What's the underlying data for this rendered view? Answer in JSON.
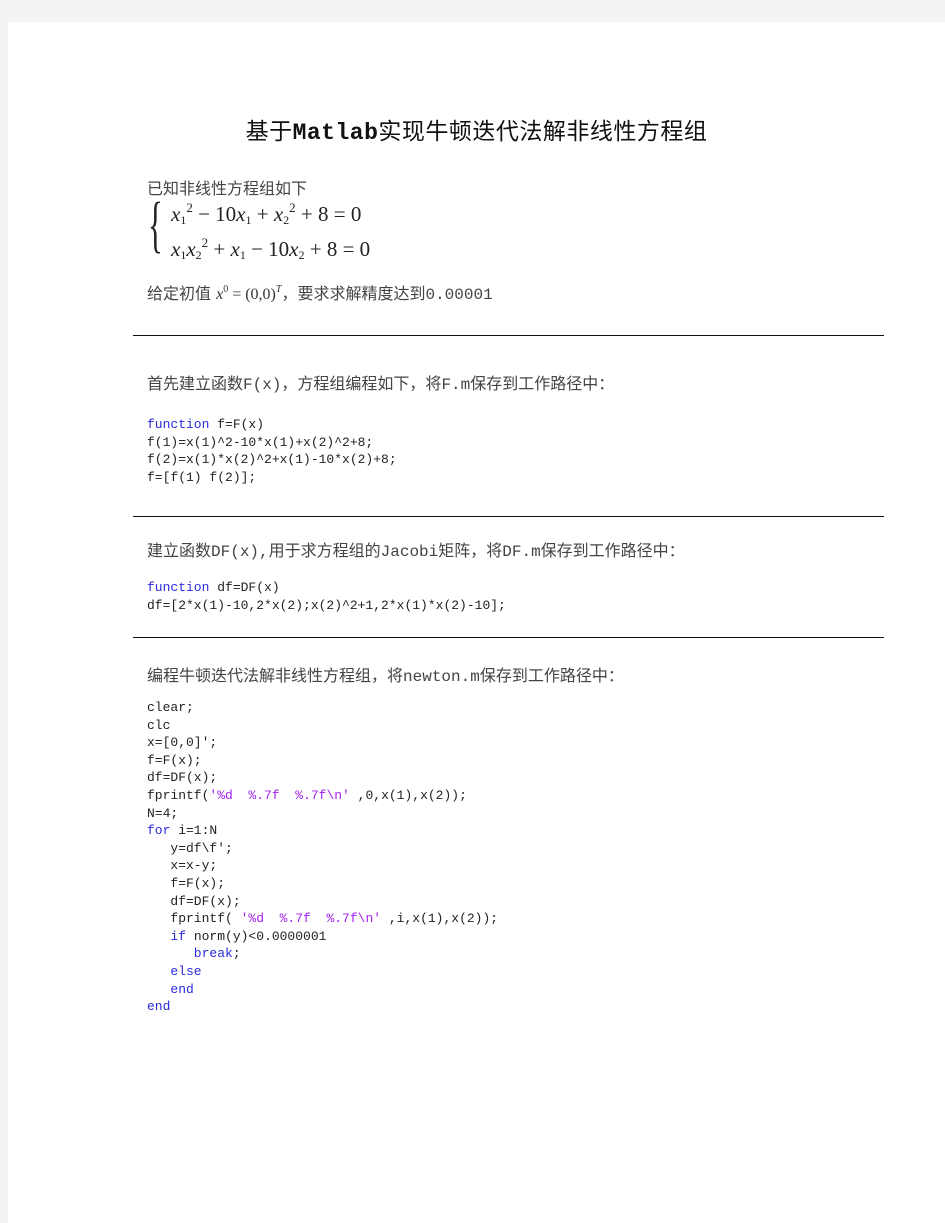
{
  "document": {
    "title_prefix": "基于",
    "title_mono": "Matlab",
    "title_suffix": "实现牛顿迭代法解非线性方程组",
    "intro": "已知非线性方程组如下",
    "equations": {
      "eq1": {
        "t1": "x",
        "s1": "1",
        "p1": "2",
        "t2": " − 10",
        "t3": "x",
        "s3": "1",
        "t4": " + ",
        "t5": "x",
        "s5": "2",
        "p5": "2",
        "t6": " + 8 = 0"
      },
      "eq2": {
        "t1": "x",
        "s1": "1",
        "t2": "x",
        "s2": "2",
        "p2": "2",
        "t3": " + ",
        "t4": "x",
        "s4": "1",
        "t5": " − 10",
        "t6": "x",
        "s6": "2",
        "t7": " + 8 = 0"
      }
    },
    "initial": {
      "prefix": "给定初值 ",
      "var": "x",
      "var_sup": "0",
      "eq": " = (0,0)",
      "transpose": "T",
      "mid": "，要求求解精度达到",
      "precision": "0.00001"
    },
    "sections": [
      {
        "heading_parts": [
          "首先建立函数",
          "F(x)",
          "，方程组编程如下，将",
          "F.m",
          "保存到工作路径中："
        ],
        "code": [
          [
            {
              "kw": "function"
            },
            {
              "t": " f=F(x)"
            }
          ],
          [
            {
              "t": "f(1)=x(1)^2-10*x(1)+x(2)^2+8;"
            }
          ],
          [
            {
              "t": "f(2)=x(1)*x(2)^2+x(1)-10*x(2)+8;"
            }
          ],
          [
            {
              "t": "f=[f(1) f(2)];"
            }
          ]
        ]
      },
      {
        "heading_parts": [
          "建立函数",
          "DF(x),",
          "用于求方程组的",
          "Jacobi",
          "矩阵，将",
          "DF.m",
          "保存到工作路径中："
        ],
        "code": [
          [
            {
              "kw": "function"
            },
            {
              "t": " df=DF(x)"
            }
          ],
          [
            {
              "t": "df=[2*x(1)-10,2*x(2);x(2)^2+1,2*x(1)*x(2)-10];"
            }
          ]
        ]
      },
      {
        "heading_parts": [
          "编程牛顿迭代法解非线性方程组，将",
          "newton.m",
          "保存到工作路径中："
        ],
        "code": [
          [
            {
              "t": "clear;"
            }
          ],
          [
            {
              "t": "clc"
            }
          ],
          [
            {
              "t": "x=[0,0]';"
            }
          ],
          [
            {
              "t": "f=F(x);"
            }
          ],
          [
            {
              "t": "df=DF(x);"
            }
          ],
          [
            {
              "t": "fprintf("
            },
            {
              "str": "'%d  %.7f  %.7f\\n'"
            },
            {
              "t": " ,0,x(1),x(2));"
            }
          ],
          [
            {
              "t": "N=4;"
            }
          ],
          [
            {
              "kw": "for"
            },
            {
              "t": " i=1:N"
            }
          ],
          [
            {
              "t": "   y=df\\f';"
            }
          ],
          [
            {
              "t": "   x=x-y;"
            }
          ],
          [
            {
              "t": "   f=F(x);"
            }
          ],
          [
            {
              "t": "   df=DF(x);"
            }
          ],
          [
            {
              "t": "   fprintf( "
            },
            {
              "str": "'%d  %.7f  %.7f\\n'"
            },
            {
              "t": " ,i,x(1),x(2));"
            }
          ],
          [
            {
              "kw": "   if"
            },
            {
              "t": " norm(y)<0.0000001"
            }
          ],
          [
            {
              "kw": "      break"
            },
            {
              "t": ";"
            }
          ],
          [
            {
              "kw": "   else"
            }
          ],
          [
            {
              "kw": "   end"
            }
          ],
          [
            {
              "kw": "end"
            }
          ]
        ]
      }
    ]
  }
}
